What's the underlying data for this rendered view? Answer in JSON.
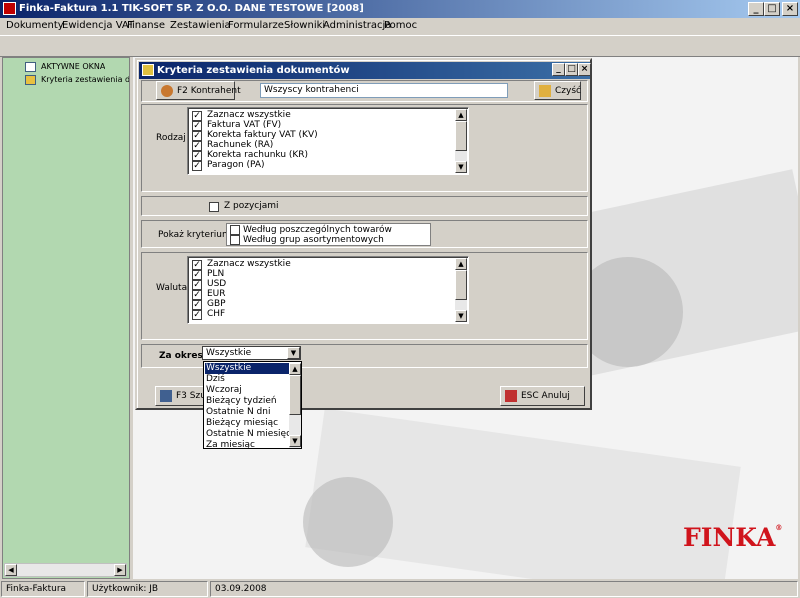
{
  "app": {
    "title": "Finka-Faktura 1.1 TIK-SOFT SP. Z O.O. DANE TESTOWE [2008]"
  },
  "window_buttons": {
    "minimize": "_",
    "maximize": "□",
    "close": "×"
  },
  "menu": [
    "Dokumenty",
    "Ewidencja VAT",
    "Finanse",
    "Zestawienia",
    "Formularze",
    "Słowniki",
    "Administracja",
    "Pomoc"
  ],
  "left_panel": {
    "root": "AKTYWNE OKNA",
    "child": "Kryteria zestawienia dok"
  },
  "dialog": {
    "title": "Kryteria zestawienia dokumentów",
    "contractor_button": "F2 Kontrahent",
    "contractor_value": "Wszyscy kontrahenci",
    "clear_button": "Czyść",
    "rodzaj_label": "Rodzaj",
    "rodzaj_items": [
      "Zaznacz wszystkie",
      "Faktura VAT  (FV)",
      "Korekta faktury VAT  (KV)",
      "Rachunek  (RA)",
      "Korekta rachunku  (KR)",
      "Paragon  (PA)"
    ],
    "z_pozycjami_label": "Z pozycjami",
    "pokaz_label": "Pokaż kryterium",
    "pokaz_items": [
      "Według poszczególnych towarów",
      "Według grup asortymentowych"
    ],
    "waluta_label": "Waluta",
    "waluta_items": [
      "Zaznacz wszystkie",
      "PLN",
      "USD",
      "EUR",
      "GBP",
      "CHF"
    ],
    "okres_label": "Za okres:",
    "okres_value": "Wszystkie",
    "search_button": "F3 Szu",
    "cancel_button": "ESC Anuluj"
  },
  "dropdown_options": [
    "Wszystkie",
    "Dziś",
    "Wczoraj",
    "Bieżący tydzień",
    "Ostatnie N dni",
    "Bieżący miesiąc",
    "Ostatnie N miesięcy",
    "Za miesiąc"
  ],
  "dropdown_selected": "Wszystkie",
  "logo": "FINKA",
  "status": {
    "app": "Finka-Faktura",
    "user": "Użytkownik: JB",
    "date": "03.09.2008"
  },
  "colors": {
    "titlebar": "#0a246a",
    "left_panel": "#b2d8b0",
    "logo": "#d0141c",
    "selection": "#0a246a"
  }
}
